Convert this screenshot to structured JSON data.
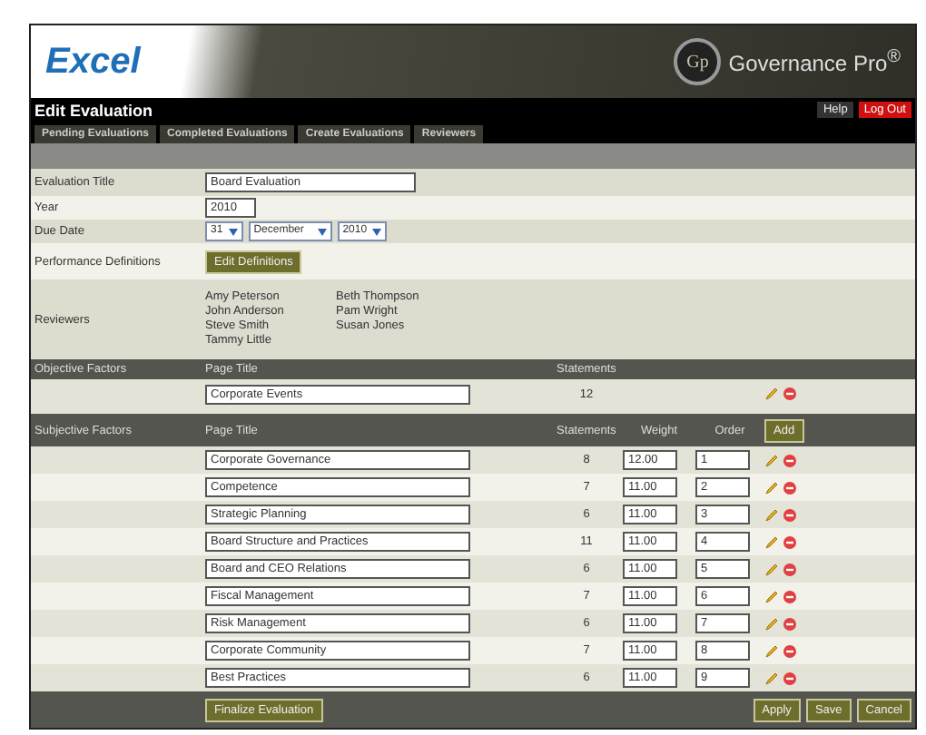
{
  "header": {
    "logo": "Excel",
    "brand": "Governance Pro$^{®}$",
    "badge": "Gp"
  },
  "title_bar": {
    "title": "Edit Evaluation",
    "links": [
      {
        "label": "Help",
        "kind": "plain"
      },
      {
        "label": "Log Out",
        "kind": "alert"
      }
    ]
  },
  "tabs": [
    {
      "label": "Pending Evaluations",
      "selected": false
    },
    {
      "label": "Completed Evaluations",
      "selected": false
    },
    {
      "label": "Create Evaluations",
      "selected": false
    },
    {
      "label": "Reviewers",
      "selected": false
    }
  ],
  "form": {
    "evaluation_title": {
      "label": "Evaluation Title",
      "value": "Board Evaluation"
    },
    "year": {
      "label": "Year",
      "value": "2010"
    },
    "due_date": {
      "label": "Due Date",
      "day": "31",
      "month": "December",
      "year": "2010"
    },
    "performance_definitions": {
      "label": "Performance Definitions",
      "button": "Edit Definitions"
    },
    "reviewers": {
      "label": "Reviewers",
      "names": [
        "Amy Peterson",
        "John Anderson",
        "Steve Smith",
        "Tammy Little",
        "Beth Thompson",
        "Pam Wright",
        "Susan Jones"
      ]
    }
  },
  "objective": {
    "headers": [
      "Objective Factors",
      "Page Title",
      "Statements"
    ],
    "rows": [
      {
        "title": "Corporate Events",
        "statements": "12"
      }
    ]
  },
  "subjective": {
    "headers": [
      "Subjective Factors",
      "Page Title",
      "Statements",
      "Weight",
      "Order"
    ],
    "add_button": "Add",
    "rows": [
      {
        "title": "Corporate Governance",
        "statements": "8",
        "weight": "12.00",
        "order": "1"
      },
      {
        "title": "Competence",
        "statements": "7",
        "weight": "11.00",
        "order": "2"
      },
      {
        "title": "Strategic Planning",
        "statements": "6",
        "weight": "11.00",
        "order": "3"
      },
      {
        "title": "Board Structure and Practices",
        "statements": "11",
        "weight": "11.00",
        "order": "4"
      },
      {
        "title": "Board and CEO Relations",
        "statements": "6",
        "weight": "11.00",
        "order": "5"
      },
      {
        "title": "Fiscal Management",
        "statements": "7",
        "weight": "11.00",
        "order": "6"
      },
      {
        "title": "Risk Management",
        "statements": "6",
        "weight": "11.00",
        "order": "7"
      },
      {
        "title": "Corporate Community",
        "statements": "7",
        "weight": "11.00",
        "order": "8"
      },
      {
        "title": "Best Practices",
        "statements": "6",
        "weight": "11.00",
        "order": "9"
      }
    ]
  },
  "footer": {
    "finalize_button": "Finalize Evaluation",
    "buttons": [
      "Apply",
      "Save",
      "Cancel"
    ]
  }
}
